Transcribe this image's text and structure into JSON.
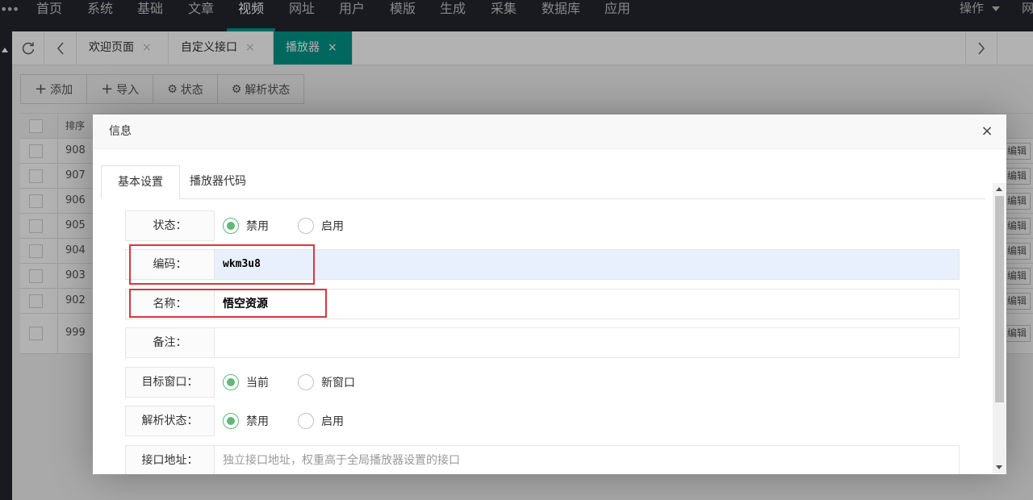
{
  "nav": {
    "items": [
      "首页",
      "系统",
      "基础",
      "文章",
      "视频",
      "网址",
      "用户",
      "模版",
      "生成",
      "采集",
      "数据库",
      "应用"
    ],
    "active_index": 4,
    "right_ops": "操作",
    "right_cut": "网"
  },
  "tabbar": {
    "tabs": [
      {
        "label": "欢迎页面",
        "close": "×"
      },
      {
        "label": "自定义接口",
        "close": "×"
      },
      {
        "label": "播放器",
        "close": "×"
      }
    ],
    "active_index": 2
  },
  "toolbar": {
    "add": "添加",
    "import": "导入",
    "status": "状态",
    "parse_status": "解析状态"
  },
  "table": {
    "header_sort": "排序",
    "rows": [
      "908",
      "907",
      "906",
      "905",
      "904",
      "903",
      "902",
      "999"
    ],
    "edit_label": "编辑"
  },
  "modal": {
    "title": "信息",
    "close": "×",
    "tabs": [
      "基本设置",
      "播放器代码"
    ],
    "active_tab": 0,
    "fields": {
      "status": {
        "label": "状态：",
        "options": [
          "禁用",
          "启用"
        ],
        "selected": 0
      },
      "code": {
        "label": "编码：",
        "value": "wkm3u8"
      },
      "name": {
        "label": "名称：",
        "value": "悟空资源"
      },
      "note": {
        "label": "备注：",
        "value": ""
      },
      "target": {
        "label": "目标窗口：",
        "options": [
          "当前",
          "新窗口"
        ],
        "selected": 0
      },
      "parse_status": {
        "label": "解析状态：",
        "options": [
          "禁用",
          "启用"
        ],
        "selected": 0
      },
      "api_url": {
        "label": "接口地址：",
        "placeholder": "独立接口地址，权重高于全局播放器设置的接口"
      }
    }
  },
  "colors": {
    "accent": "#009688",
    "radio_on": "#5fb878",
    "highlight": "#d9363e",
    "nav_bg": "#23262e"
  }
}
